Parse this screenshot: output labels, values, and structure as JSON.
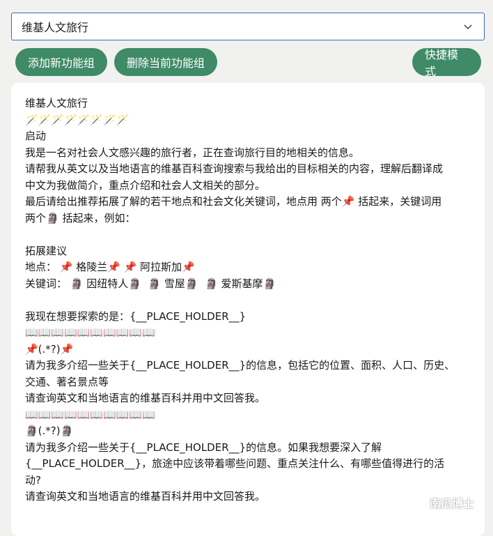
{
  "select": {
    "value": "维基人文旅行"
  },
  "buttons": {
    "add": "添加新功能组",
    "delete": "删除当前功能组",
    "fast_mode": "快捷模式"
  },
  "content": {
    "lines": [
      "维基人文旅行",
      "🪄🪄🪄🪄🪄🪄🪄🪄",
      "启动",
      "我是一名对社会人文感兴趣的旅行者，正在查询旅行目的地相关的信息。",
      "请帮我从英文以及当地语言的维基百科查询搜索与我给出的目标相关的内容，理解后翻译成",
      "中文为我做简介，重点介绍和社会人文相关的部分。",
      "最后请给出推荐拓展了解的若干地点和社会文化关键词，地点用 两个📌 括起来，关键词用",
      "两个🗿 括起来，例如：",
      "",
      "拓展建议",
      "地点： 📌 格陵兰📌 📌 阿拉斯加📌",
      "关键词： 🗿 因纽特人🗿  🗿 雪屋🗿  🗿 爱斯基摩🗿",
      "",
      "我现在想要探索的是：{__PLACE_HOLDER__}",
      "📖📖📖📖📖📖📖📖📖📖",
      "📌(.*?)📌",
      "请为我多介绍一些关于{__PLACE_HOLDER__}的信息，包括它的位置、面积、人口、历史、",
      "交通、著名景点等",
      "请查询英文和当地语言的维基百科并用中文回答我。",
      "📖📖📖📖📖📖📖📖📖📖",
      "🗿(.*?)🗿",
      "请为我多介绍一些关于{__PLACE_HOLDER__}的信息。如果我想要深入了解",
      "{__PLACE_HOLDER__}，旅途中应该带着哪些问题、重点关注什么、有哪些值得进行的活",
      "动?",
      "请查询英文和当地语言的维基百科并用中文回答我。"
    ]
  },
  "watermark": {
    "text": "南瓜博士"
  },
  "colors": {
    "button_bg": "#3f8a67",
    "select_border": "#3b67b7",
    "page_bg": "#f1f1f0"
  }
}
